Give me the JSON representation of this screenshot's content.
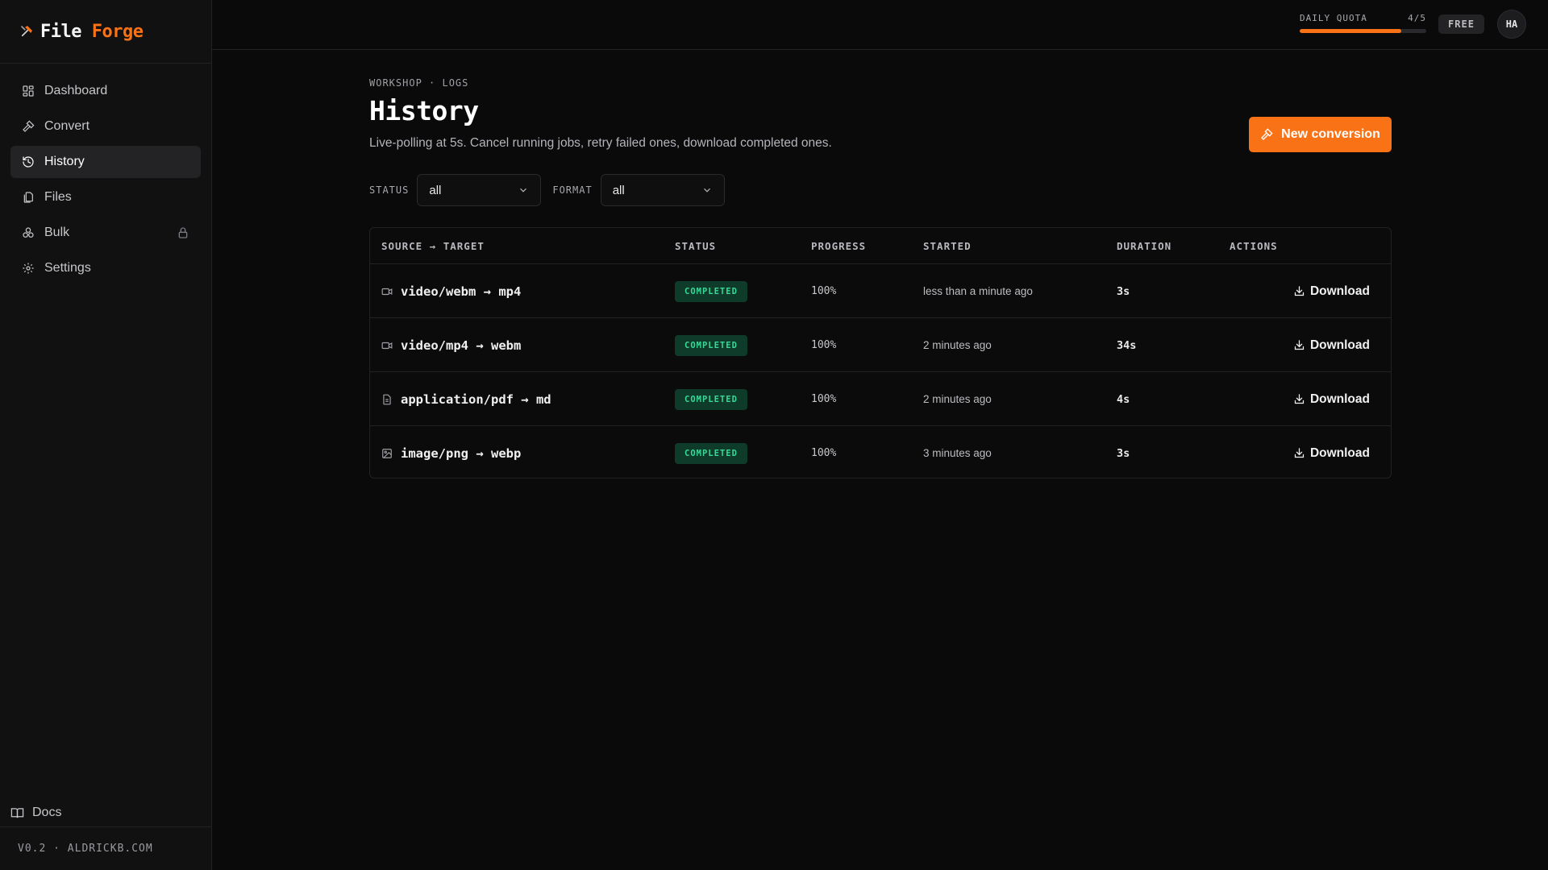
{
  "brand": {
    "name_a": "File",
    "name_b": "Forge"
  },
  "sidebar": {
    "items": [
      {
        "label": "Dashboard",
        "icon": "grid-icon"
      },
      {
        "label": "Convert",
        "icon": "hammer-icon"
      },
      {
        "label": "History",
        "icon": "history-icon",
        "active": true
      },
      {
        "label": "Files",
        "icon": "files-icon"
      },
      {
        "label": "Bulk",
        "icon": "boxes-icon",
        "locked": true
      },
      {
        "label": "Settings",
        "icon": "gear-icon"
      }
    ],
    "docs_label": "Docs",
    "footer": "V0.2 · ALDRICKB.COM"
  },
  "topbar": {
    "quota_label": "DAILY QUOTA",
    "quota_value": "4/5",
    "quota_fraction": 0.8,
    "plan": "FREE",
    "avatar_initials": "HA"
  },
  "main": {
    "breadcrumb": "WORKSHOP · LOGS",
    "title": "History",
    "subtitle": "Live-polling at 5s. Cancel running jobs, retry failed ones, download completed ones.",
    "new_button_label": "New conversion",
    "filters": {
      "status_label": "STATUS",
      "status_value": "all",
      "format_label": "FORMAT",
      "format_value": "all"
    },
    "table": {
      "headers": {
        "source_target": "SOURCE → TARGET",
        "status": "STATUS",
        "progress": "PROGRESS",
        "started": "STARTED",
        "duration": "DURATION",
        "actions": "ACTIONS"
      },
      "rows": [
        {
          "conversion": "video/webm → mp4",
          "icon": "video-icon",
          "status": "COMPLETED",
          "progress": "100%",
          "started": "less than a minute ago",
          "duration": "3s",
          "action": "Download"
        },
        {
          "conversion": "video/mp4 → webm",
          "icon": "video-icon",
          "status": "COMPLETED",
          "progress": "100%",
          "started": "2 minutes ago",
          "duration": "34s",
          "action": "Download"
        },
        {
          "conversion": "application/pdf → md",
          "icon": "document-icon",
          "status": "COMPLETED",
          "progress": "100%",
          "started": "2 minutes ago",
          "duration": "4s",
          "action": "Download"
        },
        {
          "conversion": "image/png → webp",
          "icon": "image-icon",
          "status": "COMPLETED",
          "progress": "100%",
          "started": "3 minutes ago",
          "duration": "3s",
          "action": "Download"
        }
      ]
    }
  },
  "colors": {
    "accent": "#f97316",
    "success_bg": "#0f3b2b",
    "success_text": "#38d996"
  }
}
